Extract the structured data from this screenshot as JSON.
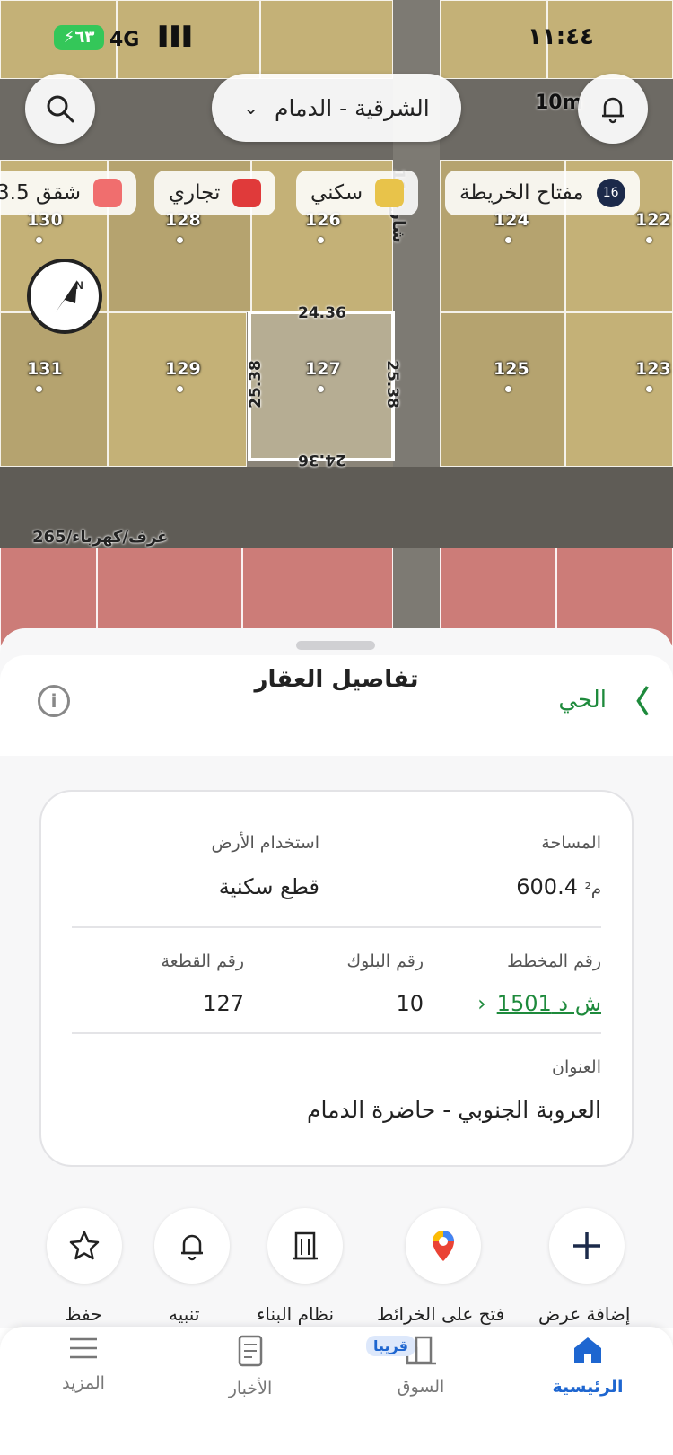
{
  "status_bar": {
    "time": "١١:٤٤",
    "network": "4G",
    "battery": "٦٣"
  },
  "map": {
    "region_selector": "الشرقية - الدمام",
    "scale": "10m",
    "legend": [
      {
        "label": "مفتاح الخريطة",
        "badge": "16",
        "color": null
      },
      {
        "label": "سكني",
        "color": "#e8c34a"
      },
      {
        "label": "تجاري",
        "color": "#e03a3a"
      },
      {
        "label": "شقق 3.5",
        "color": "#f06e6e"
      }
    ],
    "street": "شارع 11",
    "parcels_top": [
      "130",
      "128",
      "126",
      "124",
      "122"
    ],
    "parcels_mid": [
      "131",
      "129",
      "127",
      "125",
      "123"
    ],
    "selected_parcel": {
      "number": "127",
      "top": "24.36",
      "bottom": "24.36",
      "left": "25.38",
      "right": "25.38"
    },
    "utility_label": "غرف/كهرباء/265"
  },
  "sheet": {
    "title": "تفاصيل العقار",
    "neighborhood_link": "الحي",
    "area_label": "المساحة",
    "area_value": "600.4",
    "area_unit": "م²",
    "land_use_label": "استخدام الأرض",
    "land_use_value": "قطع سكنية",
    "plan_label": "رقم المخطط",
    "plan_value": "ش د 1501",
    "block_label": "رقم البلوك",
    "block_value": "10",
    "parcel_label": "رقم القطعة",
    "parcel_value": "127",
    "address_label": "العنوان",
    "address_value": "العروبة الجنوبي - حاضرة الدمام"
  },
  "actions": [
    {
      "label": "إضافة عرض",
      "icon": "plus-icon"
    },
    {
      "label": "فتح على الخرائط",
      "icon": "google-maps-icon"
    },
    {
      "label": "نظام البناء",
      "icon": "building-icon"
    },
    {
      "label": "تنبيه",
      "icon": "bell-icon"
    },
    {
      "label": "حفظ",
      "icon": "star-icon"
    }
  ],
  "tabbar": {
    "home": "الرئيسية",
    "market": "السوق",
    "market_badge": "قريبا",
    "news": "الأخبار",
    "more": "المزيد"
  },
  "colors": {
    "accent": "#1e66d0",
    "green": "#1e8a3c"
  }
}
